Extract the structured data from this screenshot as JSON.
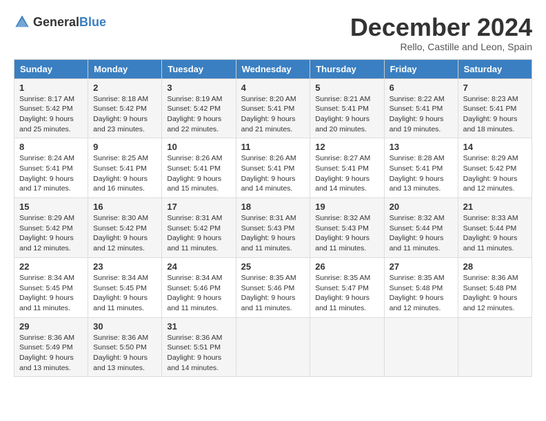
{
  "logo": {
    "text_general": "General",
    "text_blue": "Blue"
  },
  "title": "December 2024",
  "subtitle": "Rello, Castille and Leon, Spain",
  "weekdays": [
    "Sunday",
    "Monday",
    "Tuesday",
    "Wednesday",
    "Thursday",
    "Friday",
    "Saturday"
  ],
  "weeks": [
    [
      {
        "day": "1",
        "sunrise": "8:17 AM",
        "sunset": "5:42 PM",
        "daylight": "9 hours and 25 minutes."
      },
      {
        "day": "2",
        "sunrise": "8:18 AM",
        "sunset": "5:42 PM",
        "daylight": "9 hours and 23 minutes."
      },
      {
        "day": "3",
        "sunrise": "8:19 AM",
        "sunset": "5:42 PM",
        "daylight": "9 hours and 22 minutes."
      },
      {
        "day": "4",
        "sunrise": "8:20 AM",
        "sunset": "5:41 PM",
        "daylight": "9 hours and 21 minutes."
      },
      {
        "day": "5",
        "sunrise": "8:21 AM",
        "sunset": "5:41 PM",
        "daylight": "9 hours and 20 minutes."
      },
      {
        "day": "6",
        "sunrise": "8:22 AM",
        "sunset": "5:41 PM",
        "daylight": "9 hours and 19 minutes."
      },
      {
        "day": "7",
        "sunrise": "8:23 AM",
        "sunset": "5:41 PM",
        "daylight": "9 hours and 18 minutes."
      }
    ],
    [
      {
        "day": "8",
        "sunrise": "8:24 AM",
        "sunset": "5:41 PM",
        "daylight": "9 hours and 17 minutes."
      },
      {
        "day": "9",
        "sunrise": "8:25 AM",
        "sunset": "5:41 PM",
        "daylight": "9 hours and 16 minutes."
      },
      {
        "day": "10",
        "sunrise": "8:26 AM",
        "sunset": "5:41 PM",
        "daylight": "9 hours and 15 minutes."
      },
      {
        "day": "11",
        "sunrise": "8:26 AM",
        "sunset": "5:41 PM",
        "daylight": "9 hours and 14 minutes."
      },
      {
        "day": "12",
        "sunrise": "8:27 AM",
        "sunset": "5:41 PM",
        "daylight": "9 hours and 14 minutes."
      },
      {
        "day": "13",
        "sunrise": "8:28 AM",
        "sunset": "5:41 PM",
        "daylight": "9 hours and 13 minutes."
      },
      {
        "day": "14",
        "sunrise": "8:29 AM",
        "sunset": "5:42 PM",
        "daylight": "9 hours and 12 minutes."
      }
    ],
    [
      {
        "day": "15",
        "sunrise": "8:29 AM",
        "sunset": "5:42 PM",
        "daylight": "9 hours and 12 minutes."
      },
      {
        "day": "16",
        "sunrise": "8:30 AM",
        "sunset": "5:42 PM",
        "daylight": "9 hours and 12 minutes."
      },
      {
        "day": "17",
        "sunrise": "8:31 AM",
        "sunset": "5:42 PM",
        "daylight": "9 hours and 11 minutes."
      },
      {
        "day": "18",
        "sunrise": "8:31 AM",
        "sunset": "5:43 PM",
        "daylight": "9 hours and 11 minutes."
      },
      {
        "day": "19",
        "sunrise": "8:32 AM",
        "sunset": "5:43 PM",
        "daylight": "9 hours and 11 minutes."
      },
      {
        "day": "20",
        "sunrise": "8:32 AM",
        "sunset": "5:44 PM",
        "daylight": "9 hours and 11 minutes."
      },
      {
        "day": "21",
        "sunrise": "8:33 AM",
        "sunset": "5:44 PM",
        "daylight": "9 hours and 11 minutes."
      }
    ],
    [
      {
        "day": "22",
        "sunrise": "8:34 AM",
        "sunset": "5:45 PM",
        "daylight": "9 hours and 11 minutes."
      },
      {
        "day": "23",
        "sunrise": "8:34 AM",
        "sunset": "5:45 PM",
        "daylight": "9 hours and 11 minutes."
      },
      {
        "day": "24",
        "sunrise": "8:34 AM",
        "sunset": "5:46 PM",
        "daylight": "9 hours and 11 minutes."
      },
      {
        "day": "25",
        "sunrise": "8:35 AM",
        "sunset": "5:46 PM",
        "daylight": "9 hours and 11 minutes."
      },
      {
        "day": "26",
        "sunrise": "8:35 AM",
        "sunset": "5:47 PM",
        "daylight": "9 hours and 11 minutes."
      },
      {
        "day": "27",
        "sunrise": "8:35 AM",
        "sunset": "5:48 PM",
        "daylight": "9 hours and 12 minutes."
      },
      {
        "day": "28",
        "sunrise": "8:36 AM",
        "sunset": "5:48 PM",
        "daylight": "9 hours and 12 minutes."
      }
    ],
    [
      {
        "day": "29",
        "sunrise": "8:36 AM",
        "sunset": "5:49 PM",
        "daylight": "9 hours and 13 minutes."
      },
      {
        "day": "30",
        "sunrise": "8:36 AM",
        "sunset": "5:50 PM",
        "daylight": "9 hours and 13 minutes."
      },
      {
        "day": "31",
        "sunrise": "8:36 AM",
        "sunset": "5:51 PM",
        "daylight": "9 hours and 14 minutes."
      },
      null,
      null,
      null,
      null
    ]
  ]
}
